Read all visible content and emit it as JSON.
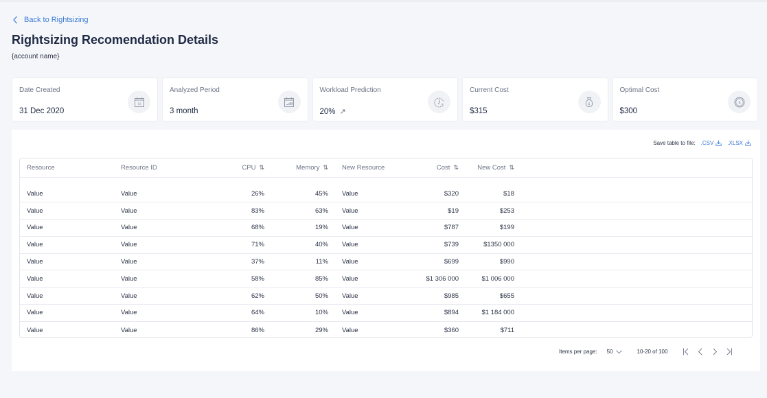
{
  "nav": {
    "back_label": "Back to Rightsizing"
  },
  "header": {
    "title": "Rightsizing Recomendation Details",
    "account_name": "{account name}"
  },
  "cards": [
    {
      "label": "Date Created",
      "value": "31 Dec 2020",
      "icon": "calendar-day-icon"
    },
    {
      "label": "Analyzed Period",
      "value": "3 month",
      "icon": "calendar-period-icon"
    },
    {
      "label": "Workload Prediction",
      "value": "20%",
      "trend": "↗",
      "icon": "clock-dollar-icon"
    },
    {
      "label": "Current Cost",
      "value": "$315",
      "icon": "money-bag-icon"
    },
    {
      "label": "Optimal Cost",
      "value": "$300",
      "icon": "coin-icon"
    }
  ],
  "export": {
    "label": "Save table to file:",
    "csv": ".CSV",
    "xlsx": ".XLSX"
  },
  "table": {
    "columns": [
      {
        "label": "Resource",
        "sortable": false
      },
      {
        "label": "Resource ID",
        "sortable": false
      },
      {
        "label": "CPU",
        "sortable": true
      },
      {
        "label": "Memory",
        "sortable": true
      },
      {
        "label": "New Resource",
        "sortable": false
      },
      {
        "label": "Cost",
        "sortable": true
      },
      {
        "label": "New Cost",
        "sortable": true
      }
    ],
    "sort_icon": "⇅",
    "rows": [
      [
        "Value",
        "Value",
        "26%",
        "45%",
        "Value",
        "$320",
        "$18"
      ],
      [
        "Value",
        "Value",
        "83%",
        "63%",
        "Value",
        "$19",
        "$253"
      ],
      [
        "Value",
        "Value",
        "68%",
        "19%",
        "Value",
        "$787",
        "$199"
      ],
      [
        "Value",
        "Value",
        "71%",
        "40%",
        "Value",
        "$739",
        "$1350 000"
      ],
      [
        "Value",
        "Value",
        "37%",
        "11%",
        "Value",
        "$699",
        "$990"
      ],
      [
        "Value",
        "Value",
        "58%",
        "85%",
        "Value",
        "$1 306 000",
        "$1 006 000"
      ],
      [
        "Value",
        "Value",
        "62%",
        "50%",
        "Value",
        "$985",
        "$655"
      ],
      [
        "Value",
        "Value",
        "64%",
        "10%",
        "Value",
        "$894",
        "$1 184 000"
      ],
      [
        "Value",
        "Value",
        "86%",
        "29%",
        "Value",
        "$360",
        "$711"
      ]
    ]
  },
  "pagination": {
    "items_per_page_label": "Items per page:",
    "items_per_page": "50",
    "range": "10-20 of 100"
  }
}
